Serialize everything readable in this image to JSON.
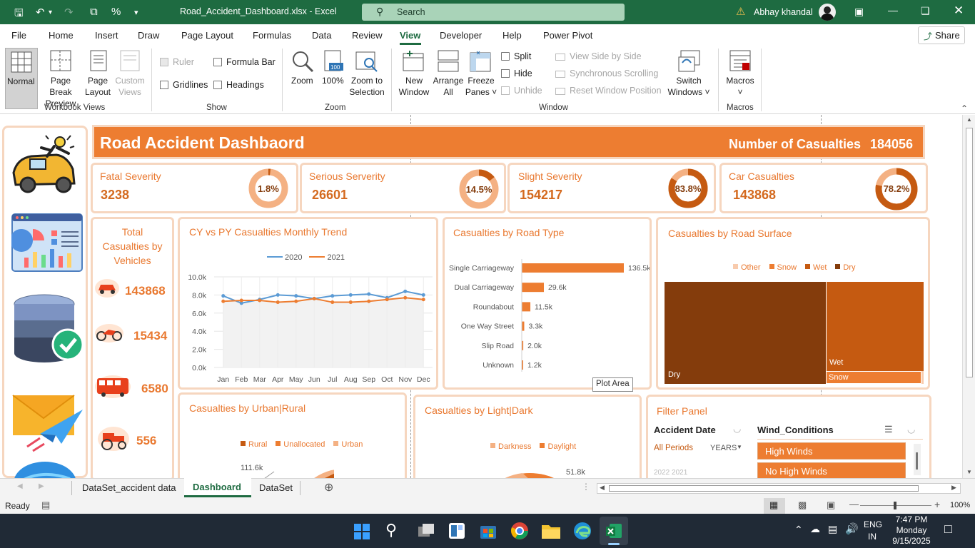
{
  "title_bar": {
    "file_title": "Road_Accident_Dashboard.xlsx  -  Excel",
    "search_placeholder": "Search",
    "user_name": "Abhay khandal"
  },
  "ribbon_tabs": [
    "File",
    "Home",
    "Insert",
    "Draw",
    "Page Layout",
    "Formulas",
    "Data",
    "Review",
    "View",
    "Developer",
    "Help",
    "Power Pivot"
  ],
  "active_tab": "View",
  "share_label": "Share",
  "ribbon": {
    "workbook_views": {
      "normal": "Normal",
      "page_break": [
        "Page Break",
        "Preview"
      ],
      "page_layout": [
        "Page",
        "Layout"
      ],
      "custom_views": [
        "Custom",
        "Views"
      ],
      "group": "Workbook Views"
    },
    "show": {
      "ruler": "Ruler",
      "gridlines": "Gridlines",
      "formula_bar": "Formula Bar",
      "headings": "Headings",
      "group": "Show"
    },
    "zoom": {
      "zoom": "Zoom",
      "hundred": "100%",
      "zoom_sel": [
        "Zoom to",
        "Selection"
      ],
      "group": "Zoom",
      "icon_text": "100"
    },
    "window": {
      "new_window": [
        "New",
        "Window"
      ],
      "arrange_all": [
        "Arrange",
        "All"
      ],
      "freeze": [
        "Freeze",
        "Panes ˅"
      ],
      "split": "Split",
      "hide": "Hide",
      "unhide": "Unhide",
      "side_by_side": "View Side by Side",
      "sync_scroll": "Synchronous Scrolling",
      "reset_pos": "Reset Window Position",
      "switch": [
        "Switch",
        "Windows ˅"
      ],
      "group": "Window"
    },
    "macros": {
      "macros": "Macros",
      "arrow": "˅",
      "group": "Macros"
    }
  },
  "dashboard": {
    "title": "Road Accident Dashbaord",
    "casualties_label": "Number of Casualties",
    "casualties_value": "184056",
    "kpis": [
      {
        "name": "Fatal Severity",
        "value": "3238",
        "pct_label": "1.8%",
        "pct": 0.018
      },
      {
        "name": "Serious Serverity",
        "value": "26601",
        "pct_label": "14.5%",
        "pct": 0.145
      },
      {
        "name": "Slight Severity",
        "value": "154217",
        "pct_label": "83.8%",
        "pct": 0.838
      },
      {
        "name": "Car Casualties",
        "value": "143868",
        "pct_label": "78.2%",
        "pct": 0.782
      }
    ],
    "vehicles": {
      "title": [
        "Total",
        "Casualties by",
        "Vehicles"
      ],
      "items": [
        {
          "icon": "car-icon",
          "value": "143868"
        },
        {
          "icon": "motorbike-icon",
          "value": "15434"
        },
        {
          "icon": "bus-icon",
          "value": "6580"
        },
        {
          "icon": "tractor-icon",
          "value": "556"
        }
      ]
    },
    "filter": {
      "title": "Filter Panel",
      "date_title": "Accident Date",
      "all_periods": "All Periods",
      "years": "YEARS",
      "wind_title": "Wind_Conditions",
      "wind_items": [
        "High Winds",
        "No High Winds"
      ],
      "years_partial": "2022   2021"
    },
    "plot_area_tooltip": "Plot Area",
    "urban_callout": "111.6k",
    "light_callout": "51.8k"
  },
  "chart_data": [
    {
      "type": "line",
      "title": "CY vs PY Casualties Monthly Trend",
      "categories": [
        "Jan",
        "Feb",
        "Mar",
        "Apr",
        "May",
        "Jun",
        "Jul",
        "Aug",
        "Sep",
        "Oct",
        "Nov",
        "Dec"
      ],
      "series": [
        {
          "name": "2020",
          "color": "#5b9bd5",
          "values": [
            7.9,
            7.1,
            7.5,
            8.0,
            7.9,
            7.6,
            7.9,
            8.0,
            8.1,
            7.7,
            8.4,
            8.0
          ]
        },
        {
          "name": "2021",
          "color": "#ed7d31",
          "values": [
            7.3,
            7.4,
            7.4,
            7.2,
            7.3,
            7.6,
            7.2,
            7.2,
            7.3,
            7.5,
            7.7,
            7.5
          ]
        }
      ],
      "yticks": [
        "0.0k",
        "2.0k",
        "4.0k",
        "6.0k",
        "8.0k",
        "10.0k"
      ],
      "ylim": [
        0,
        10
      ]
    },
    {
      "type": "bar",
      "title": "Casualties by Road Type",
      "categories": [
        "Single Carriageway",
        "Dual Carriageway",
        "Roundabout",
        "One Way Street",
        "Slip Road",
        "Unknown"
      ],
      "values": [
        136.5,
        29.6,
        11.5,
        3.3,
        2.0,
        1.2
      ],
      "labels": [
        "136.5k",
        "29.6k",
        "11.5k",
        "3.3k",
        "2.0k",
        "1.2k"
      ]
    },
    {
      "type": "treemap",
      "title": "Casualties by Road Surface",
      "legend": [
        "Other",
        "Snow",
        "Wet",
        "Dry"
      ],
      "legend_colors": [
        "#f8cbad",
        "#ed7d31",
        "#c55a11",
        "#843c0c"
      ],
      "visible_labels": [
        "Dry",
        "Wet",
        "Snow"
      ]
    },
    {
      "type": "pie",
      "title": "Casualties by Urban|Rural",
      "legend": [
        "Rural",
        "Unallocated",
        "Urban"
      ],
      "legend_colors": [
        "#c55a11",
        "#ed7d31",
        "#f4b183"
      ]
    },
    {
      "type": "pie",
      "title": "Casualties by Light|Dark",
      "legend": [
        "Darkness",
        "Daylight"
      ],
      "legend_colors": [
        "#f4b183",
        "#ed7d31"
      ]
    }
  ],
  "sheet_tabs": [
    "DataSet_accident data",
    "Dashboard",
    "DataSet"
  ],
  "active_sheet": "Dashboard",
  "status": {
    "ready": "Ready",
    "zoom": "100%"
  },
  "taskbar": {
    "lang1": "ENG",
    "lang2": "IN",
    "time": "7:47 PM",
    "day": "Monday",
    "date": "9/15/2025"
  }
}
